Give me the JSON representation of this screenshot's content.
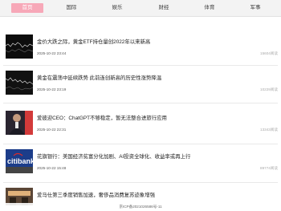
{
  "nav": {
    "tabs": [
      {
        "label": "首页",
        "active": true
      },
      {
        "label": "国际",
        "active": false
      },
      {
        "label": "娱乐",
        "active": false
      },
      {
        "label": "财经",
        "active": false
      },
      {
        "label": "体育",
        "active": false
      },
      {
        "label": "军事",
        "active": false
      }
    ]
  },
  "news": [
    {
      "title": "金价大跌之际，黄金ETF持仓量创2022年以来新高",
      "time": "2025-10-22 23:44",
      "views": "15604阅读",
      "thumb_icon": "stock-chart-thumbnail"
    },
    {
      "title": "黄金在震荡中延续跌势  此前连创新高的历史性涨势降温",
      "time": "2025-10-22 23:19",
      "views": "10229阅读",
      "thumb_icon": "stock-chart-thumbnail"
    },
    {
      "title": "爱彼迎CEO：ChatGPT不够稳定，暂无法整合进旅行应用",
      "time": "2025-10-22 22:31",
      "views": "13343阅读",
      "thumb_icon": "speaker-photo-thumbnail"
    },
    {
      "title": "花旗银行：美国经济贫富分化加剧、AI投资全球化、收益率或再上行",
      "time": "2025-10-22 15:48",
      "views": "89774阅读",
      "thumb_icon": "citibank-sign-thumbnail",
      "thumb_text": "citibank"
    },
    {
      "title": "爱马仕第三季度销售加速，奢侈品消费复苏迹象增强",
      "time": "",
      "views": "",
      "thumb_icon": "storefront-thumbnail"
    }
  ],
  "footer": {
    "icp": "京ICP备2021026586号-11"
  },
  "colors": {
    "active_tab": "#f7a8b8",
    "nav_bg": "#f3f3f3"
  }
}
